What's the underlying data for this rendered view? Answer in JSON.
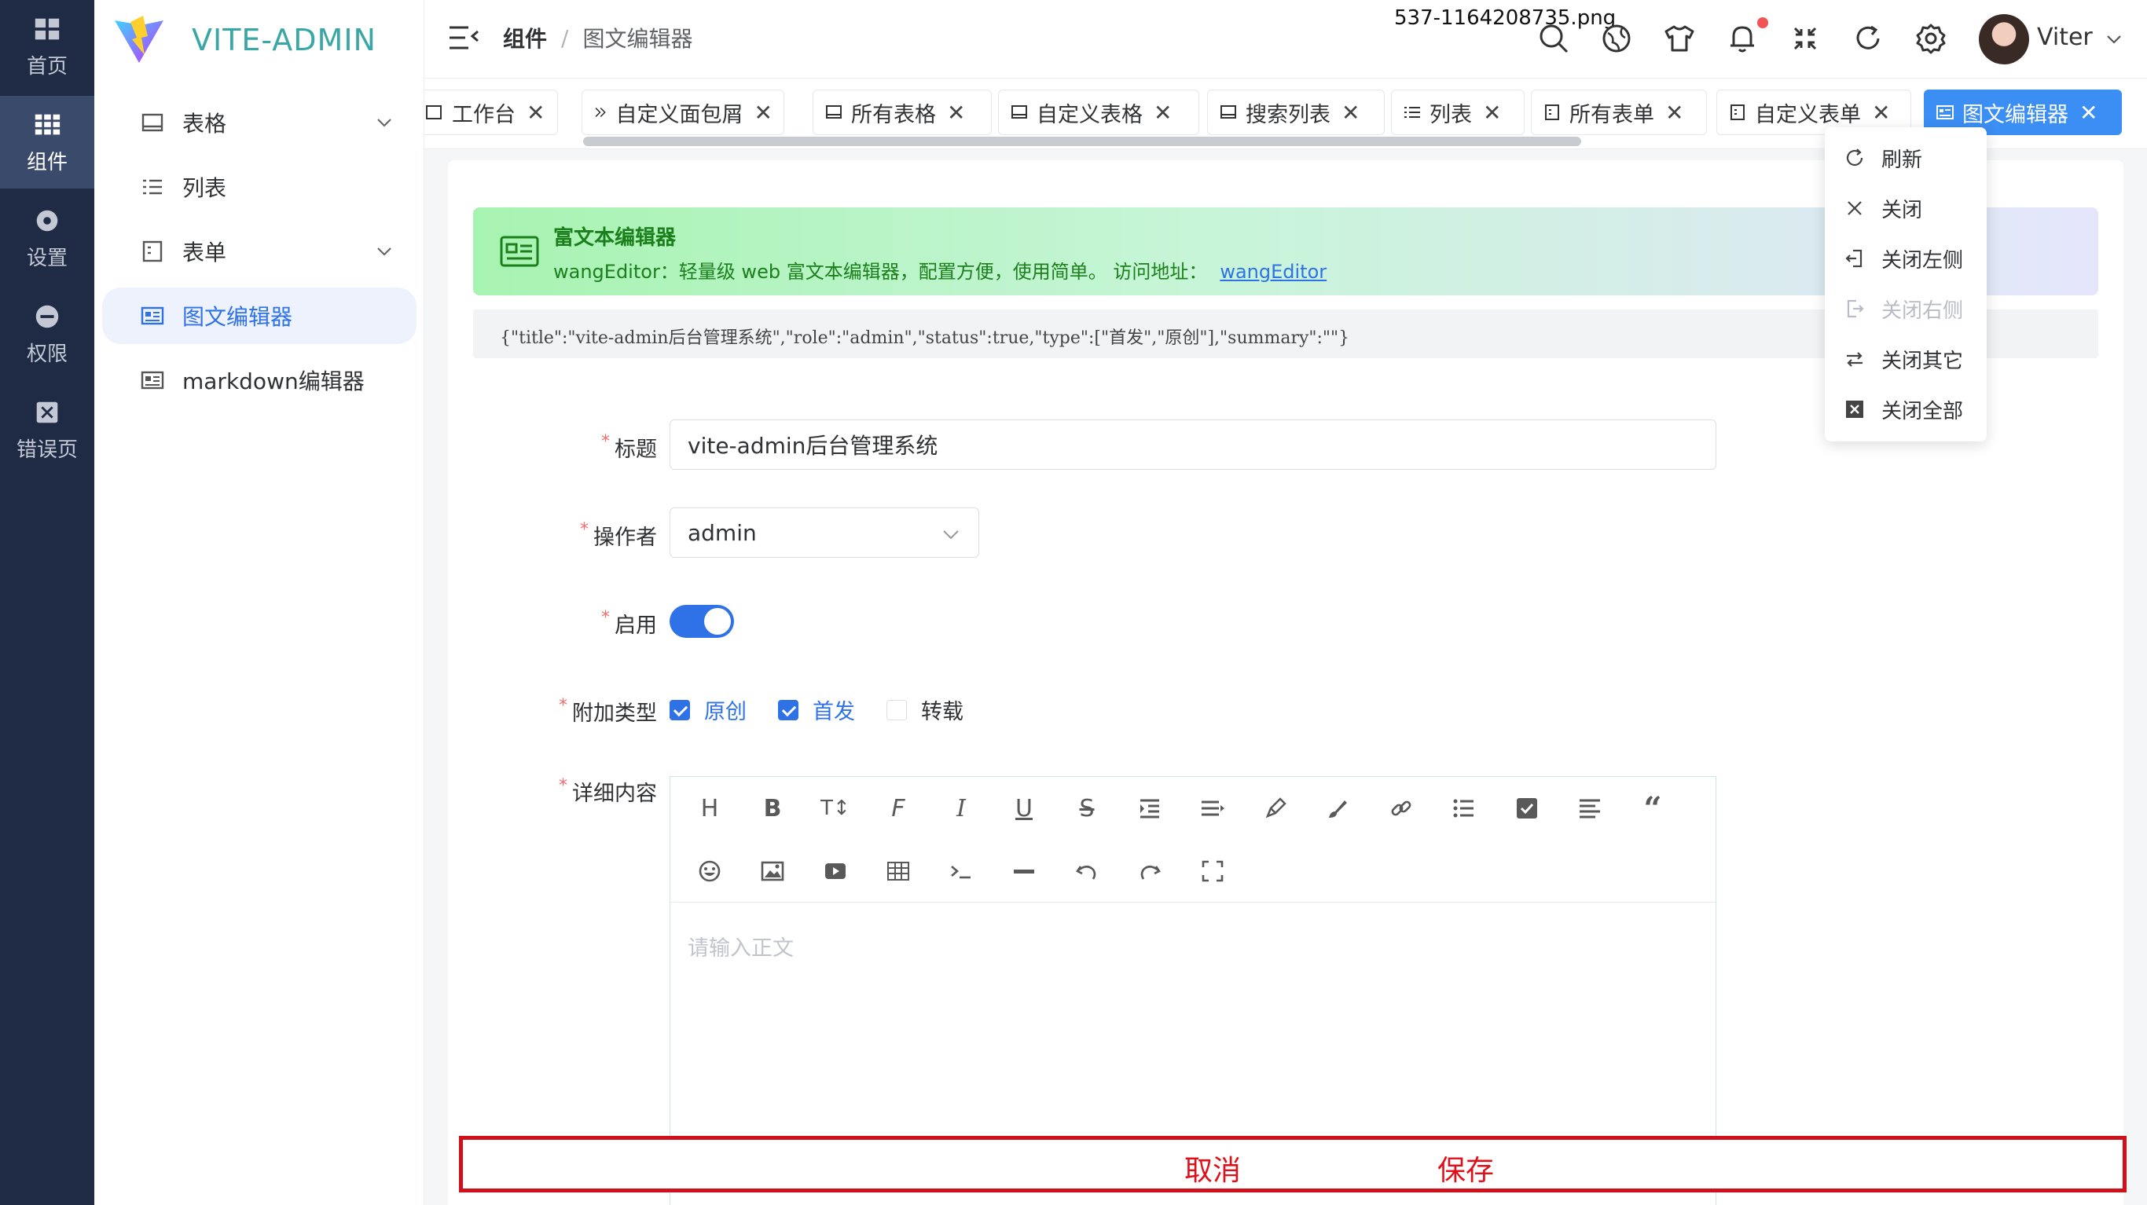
{
  "window": {
    "filename": "537-1164208735.png"
  },
  "rail": [
    {
      "label": "首页",
      "icon": "home-icon",
      "active": false
    },
    {
      "label": "组件",
      "icon": "grid-icon",
      "active": true
    },
    {
      "label": "设置",
      "icon": "gear-icon",
      "active": false
    },
    {
      "label": "权限",
      "icon": "minus-circle-icon",
      "active": false
    },
    {
      "label": "错误页",
      "icon": "error-box-icon",
      "active": false
    }
  ],
  "logo": {
    "text": "VITE-ADMIN"
  },
  "submenu": [
    {
      "label": "表格",
      "icon": "table-icon",
      "has_children": true
    },
    {
      "label": "列表",
      "icon": "list-icon",
      "has_children": false
    },
    {
      "label": "表单",
      "icon": "form-icon",
      "has_children": true
    },
    {
      "label": "图文编辑器",
      "icon": "editor-icon",
      "has_children": false,
      "active": true
    },
    {
      "label": "markdown编辑器",
      "icon": "editor-icon",
      "has_children": false
    }
  ],
  "breadcrumb": {
    "parent": "组件",
    "separator": "/",
    "current": "图文编辑器"
  },
  "header_icons": [
    "search-icon",
    "globe-icon",
    "shirt-icon",
    "bell-icon",
    "fullscreen-exit-icon",
    "refresh-icon",
    "gear-icon"
  ],
  "user": {
    "name": "Viter"
  },
  "tabs": [
    {
      "label": "工作台",
      "icon": "home-icon"
    },
    {
      "label": "自定义面包屑",
      "icon": "double-chevron-icon"
    },
    {
      "label": "所有表格",
      "icon": "table-icon"
    },
    {
      "label": "自定义表格",
      "icon": "table-icon"
    },
    {
      "label": "搜索列表",
      "icon": "table-icon"
    },
    {
      "label": "列表",
      "icon": "list-icon"
    },
    {
      "label": "所有表单",
      "icon": "form-icon"
    },
    {
      "label": "自定义表单",
      "icon": "form-icon"
    },
    {
      "label": "图文编辑器",
      "icon": "editor-icon",
      "active": true
    }
  ],
  "alert": {
    "title": "富文本编辑器",
    "desc": "wangEditor：轻量级 web 富文本编辑器，配置方便，使用简单。 访问地址：",
    "link": "wangEditor"
  },
  "json_preview": "{\"title\":\"vite-admin后台管理系统\",\"role\":\"admin\",\"status\":true,\"type\":[\"首发\",\"原创\"],\"summary\":\"\"}",
  "form": {
    "title_label": "标题",
    "title_value": "vite-admin后台管理系统",
    "operator_label": "操作者",
    "operator_value": "admin",
    "enabled_label": "启用",
    "enabled": true,
    "type_label": "附加类型",
    "types": [
      {
        "label": "原创",
        "checked": true
      },
      {
        "label": "首发",
        "checked": true
      },
      {
        "label": "转载",
        "checked": false
      }
    ],
    "detail_label": "详细内容",
    "editor_placeholder": "请输入正文"
  },
  "footer": {
    "cancel": "取消",
    "save": "保存"
  },
  "context_menu": [
    {
      "label": "刷新",
      "icon": "refresh-icon",
      "disabled": false
    },
    {
      "label": "关闭",
      "icon": "close-icon",
      "disabled": false
    },
    {
      "label": "关闭左侧",
      "icon": "close-left-icon",
      "disabled": false
    },
    {
      "label": "关闭右侧",
      "icon": "close-right-icon",
      "disabled": true
    },
    {
      "label": "关闭其它",
      "icon": "swap-icon",
      "disabled": false
    },
    {
      "label": "关闭全部",
      "icon": "close-all-icon",
      "disabled": false
    }
  ],
  "colors": {
    "accent": "#2f72e8",
    "rail_bg": "#1f2a44",
    "highlight": "#d0101b"
  }
}
